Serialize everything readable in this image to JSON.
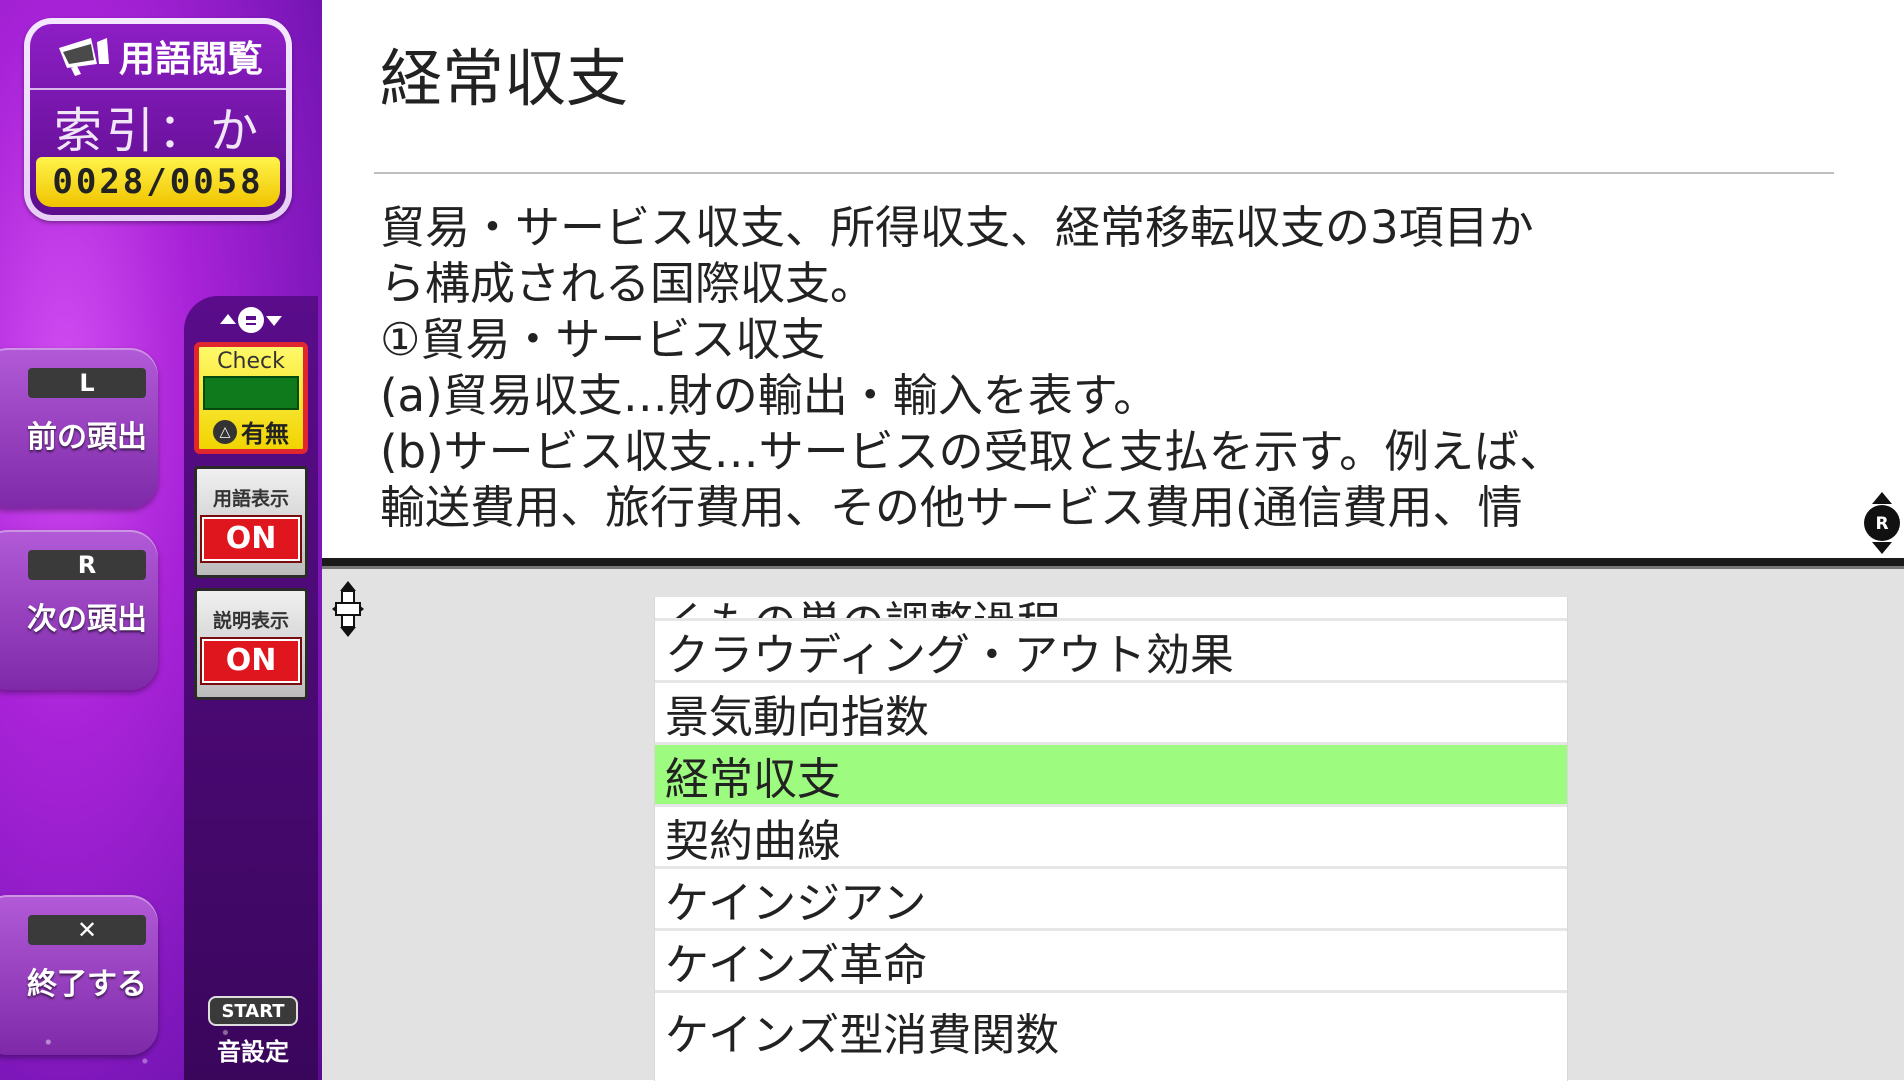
{
  "header": {
    "mode_label": "用語閲覧",
    "index_label": "索引：か",
    "counter": "0028/0058"
  },
  "sidebar": {
    "prev_button": {
      "key": "L",
      "label": "前の頭出"
    },
    "next_button": {
      "key": "R",
      "label": "次の頭出"
    },
    "exit_button": {
      "key": "✕",
      "label": "終了する"
    },
    "check": {
      "title": "Check",
      "foot": "有無",
      "foot_key": "△"
    },
    "term_display": {
      "label": "用語表示",
      "state": "ON"
    },
    "desc_display": {
      "label": "説明表示",
      "state": "ON"
    },
    "start": {
      "key": "START",
      "label": "音設定"
    }
  },
  "description": {
    "term": "経常収支",
    "lines": [
      "貿易・サービス収支、所得収支、経常移転収支の3項目か",
      "ら構成される国際収支。",
      "①貿易・サービス収支",
      "(a)貿易収支…財の輸出・輸入を表す。",
      "(b)サービス収支…サービスの受取と支払を示す。例えば、",
      "輸送費用、旅行費用、その他サービス費用(通信費用、情"
    ]
  },
  "list": {
    "partial_top": "くもの巣の調整過程",
    "items": [
      "クラウディング・アウト効果",
      "景気動向指数",
      "経常収支",
      "契約曲線",
      "ケインジアン",
      "ケインズ革命"
    ],
    "partial_bottom": "ケインズ型消費関数",
    "selected_index": 2
  },
  "colors": {
    "sidebar_purple": "#a923d8",
    "selected_row": "#9dfb7f",
    "toggle_on": "#e0161e",
    "counter_yellow": "#f0c400"
  }
}
